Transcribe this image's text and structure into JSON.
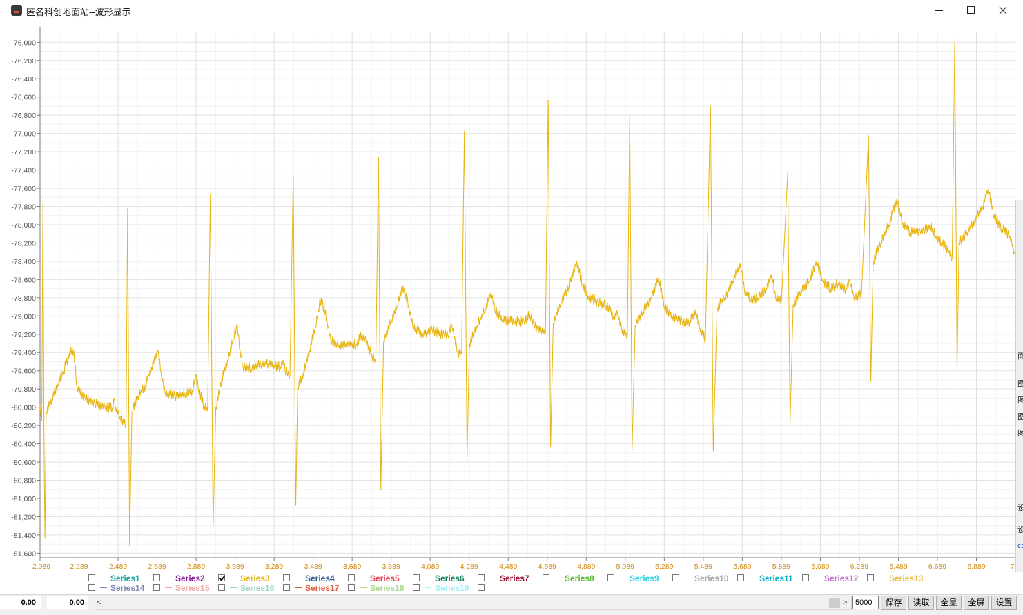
{
  "window": {
    "title": "匿名科创地面站--波形显示",
    "icons": {
      "app": "app-logo-icon",
      "minimize": "minimize-icon",
      "maximize": "maximize-icon",
      "close": "close-icon"
    }
  },
  "chart_data": {
    "type": "line",
    "title": "",
    "xlabel": "",
    "ylabel": "",
    "xlim": [
      2089,
      7089
    ],
    "ylim": [
      -81650,
      -75960
    ],
    "grid": true,
    "xticks": [
      {
        "v": 2089,
        "label": "2,089"
      },
      {
        "v": 2289,
        "label": "2,289"
      },
      {
        "v": 2489,
        "label": "2,489"
      },
      {
        "v": 2689,
        "label": "2,689"
      },
      {
        "v": 2889,
        "label": "2,889"
      },
      {
        "v": 3089,
        "label": "3,089"
      },
      {
        "v": 3289,
        "label": "3,289"
      },
      {
        "v": 3489,
        "label": "3,489"
      },
      {
        "v": 3689,
        "label": "3,689"
      },
      {
        "v": 3889,
        "label": "3,889"
      },
      {
        "v": 4089,
        "label": "4,089"
      },
      {
        "v": 4289,
        "label": "4,289"
      },
      {
        "v": 4489,
        "label": "4,489"
      },
      {
        "v": 4689,
        "label": "4,689"
      },
      {
        "v": 4889,
        "label": "4,889"
      },
      {
        "v": 5089,
        "label": "5,089"
      },
      {
        "v": 5289,
        "label": "5,289"
      },
      {
        "v": 5489,
        "label": "5,489"
      },
      {
        "v": 5689,
        "label": "5,689"
      },
      {
        "v": 5889,
        "label": "5,889"
      },
      {
        "v": 6089,
        "label": "6,089"
      },
      {
        "v": 6289,
        "label": "6,289"
      },
      {
        "v": 6489,
        "label": "6,489"
      },
      {
        "v": 6689,
        "label": "6,689"
      },
      {
        "v": 6889,
        "label": "6,889"
      },
      {
        "v": 7089,
        "label": "7,0"
      }
    ],
    "yticks": [
      {
        "v": -76000,
        "label": "-76,000"
      },
      {
        "v": -76200,
        "label": "-76,200"
      },
      {
        "v": -76400,
        "label": "-76,400"
      },
      {
        "v": -76600,
        "label": "-76,600"
      },
      {
        "v": -76800,
        "label": "-76,800"
      },
      {
        "v": -77000,
        "label": "-77,000"
      },
      {
        "v": -77200,
        "label": "-77,200"
      },
      {
        "v": -77400,
        "label": "-77,400"
      },
      {
        "v": -77600,
        "label": "-77,600"
      },
      {
        "v": -77800,
        "label": "-77,800"
      },
      {
        "v": -78000,
        "label": "-78,000"
      },
      {
        "v": -78200,
        "label": "-78,200"
      },
      {
        "v": -78400,
        "label": "-78,400"
      },
      {
        "v": -78600,
        "label": "-78,600"
      },
      {
        "v": -78800,
        "label": "-78,800"
      },
      {
        "v": -79000,
        "label": "-79,000"
      },
      {
        "v": -79200,
        "label": "-79,200"
      },
      {
        "v": -79400,
        "label": "-79,400"
      },
      {
        "v": -79600,
        "label": "-79,600"
      },
      {
        "v": -79800,
        "label": "-79,800"
      },
      {
        "v": -80000,
        "label": "-80,000"
      },
      {
        "v": -80200,
        "label": "-80,200"
      },
      {
        "v": -80400,
        "label": "-80,400"
      },
      {
        "v": -80600,
        "label": "-80,600"
      },
      {
        "v": -80800,
        "label": "-80,800"
      },
      {
        "v": -81000,
        "label": "-81,000"
      },
      {
        "v": -81200,
        "label": "-81,200"
      },
      {
        "v": -81400,
        "label": "-81,400"
      },
      {
        "v": -81600,
        "label": "-81,600"
      }
    ],
    "series": [
      {
        "name": "Series3",
        "color": "#e8b30c",
        "points": [
          [
            2089,
            -79980
          ],
          [
            2098,
            -80150
          ],
          [
            2104,
            -77760
          ],
          [
            2110,
            -80550
          ],
          [
            2114,
            -81440
          ],
          [
            2120,
            -80050
          ],
          [
            2150,
            -79900
          ],
          [
            2180,
            -79750
          ],
          [
            2210,
            -79600
          ],
          [
            2240,
            -79400
          ],
          [
            2262,
            -79370
          ],
          [
            2278,
            -79780
          ],
          [
            2320,
            -79900
          ],
          [
            2370,
            -79960
          ],
          [
            2420,
            -79990
          ],
          [
            2460,
            -80010
          ],
          [
            2470,
            -79900
          ],
          [
            2475,
            -80000
          ],
          [
            2500,
            -80100
          ],
          [
            2530,
            -80200
          ],
          [
            2538,
            -77820
          ],
          [
            2548,
            -81520
          ],
          [
            2560,
            -80050
          ],
          [
            2590,
            -79880
          ],
          [
            2630,
            -79760
          ],
          [
            2660,
            -79560
          ],
          [
            2695,
            -79380
          ],
          [
            2710,
            -79620
          ],
          [
            2730,
            -79840
          ],
          [
            2780,
            -79880
          ],
          [
            2830,
            -79860
          ],
          [
            2870,
            -79820
          ],
          [
            2890,
            -79650
          ],
          [
            2900,
            -79800
          ],
          [
            2930,
            -79980
          ],
          [
            2948,
            -80040
          ],
          [
            2962,
            -77660
          ],
          [
            2976,
            -81320
          ],
          [
            2990,
            -80000
          ],
          [
            3020,
            -79700
          ],
          [
            3050,
            -79480
          ],
          [
            3080,
            -79250
          ],
          [
            3100,
            -79100
          ],
          [
            3115,
            -79380
          ],
          [
            3130,
            -79560
          ],
          [
            3170,
            -79580
          ],
          [
            3220,
            -79520
          ],
          [
            3260,
            -79520
          ],
          [
            3290,
            -79540
          ],
          [
            3320,
            -79560
          ],
          [
            3335,
            -79480
          ],
          [
            3345,
            -79600
          ],
          [
            3370,
            -79660
          ],
          [
            3387,
            -77460
          ],
          [
            3400,
            -81080
          ],
          [
            3410,
            -79800
          ],
          [
            3440,
            -79620
          ],
          [
            3470,
            -79380
          ],
          [
            3500,
            -79120
          ],
          [
            3530,
            -78800
          ],
          [
            3560,
            -79050
          ],
          [
            3580,
            -79280
          ],
          [
            3620,
            -79320
          ],
          [
            3670,
            -79320
          ],
          [
            3710,
            -79310
          ],
          [
            3740,
            -79200
          ],
          [
            3760,
            -79280
          ],
          [
            3790,
            -79420
          ],
          [
            3810,
            -79520
          ],
          [
            3824,
            -77260
          ],
          [
            3836,
            -80900
          ],
          [
            3850,
            -79280
          ],
          [
            3890,
            -79050
          ],
          [
            3920,
            -78880
          ],
          [
            3950,
            -78670
          ],
          [
            3980,
            -78900
          ],
          [
            4000,
            -79120
          ],
          [
            4050,
            -79200
          ],
          [
            4100,
            -79160
          ],
          [
            4160,
            -79200
          ],
          [
            4180,
            -79220
          ],
          [
            4200,
            -79100
          ],
          [
            4230,
            -79400
          ],
          [
            4250,
            -79420
          ],
          [
            4264,
            -76970
          ],
          [
            4278,
            -80560
          ],
          [
            4290,
            -79300
          ],
          [
            4330,
            -79100
          ],
          [
            4370,
            -78940
          ],
          [
            4400,
            -78740
          ],
          [
            4420,
            -78920
          ],
          [
            4460,
            -79040
          ],
          [
            4520,
            -79060
          ],
          [
            4570,
            -79060
          ],
          [
            4600,
            -78980
          ],
          [
            4620,
            -79100
          ],
          [
            4640,
            -79140
          ],
          [
            4680,
            -79180
          ],
          [
            4694,
            -76630
          ],
          [
            4706,
            -80440
          ],
          [
            4720,
            -79080
          ],
          [
            4760,
            -78850
          ],
          [
            4800,
            -78680
          ],
          [
            4840,
            -78400
          ],
          [
            4870,
            -78660
          ],
          [
            4900,
            -78780
          ],
          [
            4950,
            -78850
          ],
          [
            4990,
            -78880
          ],
          [
            5030,
            -79000
          ],
          [
            5050,
            -78980
          ],
          [
            5070,
            -79140
          ],
          [
            5100,
            -79220
          ],
          [
            5112,
            -76800
          ],
          [
            5124,
            -80470
          ],
          [
            5140,
            -79100
          ],
          [
            5180,
            -78950
          ],
          [
            5220,
            -78800
          ],
          [
            5260,
            -78580
          ],
          [
            5290,
            -78900
          ],
          [
            5330,
            -79000
          ],
          [
            5380,
            -79060
          ],
          [
            5420,
            -79060
          ],
          [
            5450,
            -78940
          ],
          [
            5470,
            -79120
          ],
          [
            5500,
            -79260
          ],
          [
            5526,
            -76700
          ],
          [
            5540,
            -80480
          ],
          [
            5560,
            -78900
          ],
          [
            5600,
            -78800
          ],
          [
            5640,
            -78620
          ],
          [
            5680,
            -78420
          ],
          [
            5700,
            -78720
          ],
          [
            5730,
            -78820
          ],
          [
            5770,
            -78800
          ],
          [
            5810,
            -78700
          ],
          [
            5840,
            -78540
          ],
          [
            5860,
            -78800
          ],
          [
            5890,
            -78830
          ],
          [
            5922,
            -77420
          ],
          [
            5934,
            -80180
          ],
          [
            5950,
            -78880
          ],
          [
            5990,
            -78720
          ],
          [
            6030,
            -78620
          ],
          [
            6070,
            -78400
          ],
          [
            6100,
            -78600
          ],
          [
            6140,
            -78700
          ],
          [
            6180,
            -78640
          ],
          [
            6220,
            -78700
          ],
          [
            6240,
            -78620
          ],
          [
            6260,
            -78780
          ],
          [
            6300,
            -78760
          ],
          [
            6336,
            -77020
          ],
          [
            6348,
            -79720
          ],
          [
            6360,
            -78400
          ],
          [
            6400,
            -78200
          ],
          [
            6440,
            -78000
          ],
          [
            6480,
            -77720
          ],
          [
            6510,
            -77980
          ],
          [
            6550,
            -78080
          ],
          [
            6600,
            -78060
          ],
          [
            6620,
            -78080
          ],
          [
            6650,
            -78000
          ],
          [
            6680,
            -78120
          ],
          [
            6710,
            -78200
          ],
          [
            6750,
            -78280
          ],
          [
            6765,
            -78360
          ],
          [
            6778,
            -76000
          ],
          [
            6790,
            -79600
          ],
          [
            6800,
            -78200
          ],
          [
            6840,
            -78080
          ],
          [
            6880,
            -77960
          ],
          [
            6920,
            -77800
          ],
          [
            6950,
            -77600
          ],
          [
            6980,
            -77900
          ],
          [
            7020,
            -78040
          ],
          [
            7060,
            -78120
          ],
          [
            7085,
            -78300
          ]
        ]
      }
    ]
  },
  "legend": {
    "items": [
      {
        "label": "Series1",
        "color": "#1aa6a0",
        "checked": false
      },
      {
        "label": "Series2",
        "color": "#8a1a9b",
        "checked": false
      },
      {
        "label": "Series3",
        "color": "#e8b30c",
        "checked": true
      },
      {
        "label": "Series4",
        "color": "#2f5e8e",
        "checked": false
      },
      {
        "label": "Series5",
        "color": "#e0465a",
        "checked": false
      },
      {
        "label": "Series6",
        "color": "#1b7f62",
        "checked": false
      },
      {
        "label": "Series7",
        "color": "#9b1133",
        "checked": false
      },
      {
        "label": "Series8",
        "color": "#5bb632",
        "checked": false
      },
      {
        "label": "Series9",
        "color": "#2bd3e0",
        "checked": false
      },
      {
        "label": "Series10",
        "color": "#a6a6a6",
        "checked": false
      },
      {
        "label": "Series11",
        "color": "#12aecf",
        "checked": false
      },
      {
        "label": "Series12",
        "color": "#c276c2",
        "checked": false
      },
      {
        "label": "Series13",
        "color": "#e9c04a",
        "checked": false
      },
      {
        "label": "Series14",
        "color": "#7d8bb0",
        "checked": false
      },
      {
        "label": "Series15",
        "color": "#f0a8a8",
        "checked": false
      },
      {
        "label": "Series16",
        "color": "#9ed3c8",
        "checked": false
      },
      {
        "label": "Series17",
        "color": "#e55a3a",
        "checked": false
      },
      {
        "label": "Series18",
        "color": "#a8d88a",
        "checked": false
      },
      {
        "label": "Series19",
        "color": "#a6eef2",
        "checked": false
      }
    ],
    "extra_checkbox": {
      "checked": false
    }
  },
  "status": {
    "value_a": "0.00",
    "value_b": "0.00"
  },
  "controls": {
    "scroll_left": "<",
    "scroll_right": ">",
    "count_value": "5000",
    "save": "保存",
    "load": "读取",
    "show_all": "全显",
    "fullscreen": "全屏",
    "settings": "设置"
  },
  "right_panel": {
    "fragments": [
      "面",
      "图",
      "图",
      "图",
      "图",
      "设",
      "设",
      "co"
    ]
  }
}
